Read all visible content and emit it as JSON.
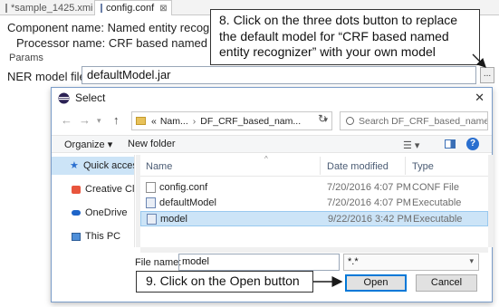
{
  "editor": {
    "tabs": [
      {
        "label": "*sample_1425.xmi"
      },
      {
        "label": "config.conf",
        "close": "⊠"
      }
    ],
    "component_line": "Component name: Named entity recogniz",
    "processor_line": "Processor name: CRF based named ent",
    "params_label": "Params",
    "ner_label": "NER model file",
    "ner_value": "defaultModel.jar",
    "dots_label": "..."
  },
  "callouts": {
    "step8": "8. Click on the three dots button to replace the default model for “CRF based named entity recognizer” with your own model",
    "step9": "9. Click on the Open button"
  },
  "dialog": {
    "title": "Select",
    "close": "✕",
    "breadcrumb": [
      "Nam...",
      "DF_CRF_based_nam..."
    ],
    "breadcrumb_prefix": "«",
    "search_placeholder": "Search DF_CRF_based_named_...",
    "toolbar": {
      "organize": "Organize ▾",
      "new_folder": "New folder"
    },
    "sidebar": [
      {
        "label": "Quick access",
        "icon": "star-icon",
        "selected": true
      },
      {
        "label": "Creative Cloud Files",
        "icon": "creative-cloud-icon"
      },
      {
        "label": "OneDrive",
        "icon": "onedrive-icon"
      },
      {
        "label": "This PC",
        "icon": "pc-icon"
      }
    ],
    "columns": {
      "name": "Name",
      "date": "Date modified",
      "type": "Type"
    },
    "files": [
      {
        "name": "config.conf",
        "date": "7/20/2016 4:07 PM",
        "type": "CONF File"
      },
      {
        "name": "defaultModel",
        "date": "7/20/2016 4:07 PM",
        "type": "Executable"
      },
      {
        "name": "model",
        "date": "9/22/2016 3:42 PM",
        "type": "Executable",
        "selected": true
      }
    ],
    "file_name_label": "File name:",
    "file_name_value": "model",
    "filter_value": "*.*",
    "open_label": "Open",
    "cancel_label": "Cancel"
  },
  "colors": {
    "selection": "#cce4f7",
    "accent": "#0078d7",
    "help": "#2a6fcf"
  }
}
